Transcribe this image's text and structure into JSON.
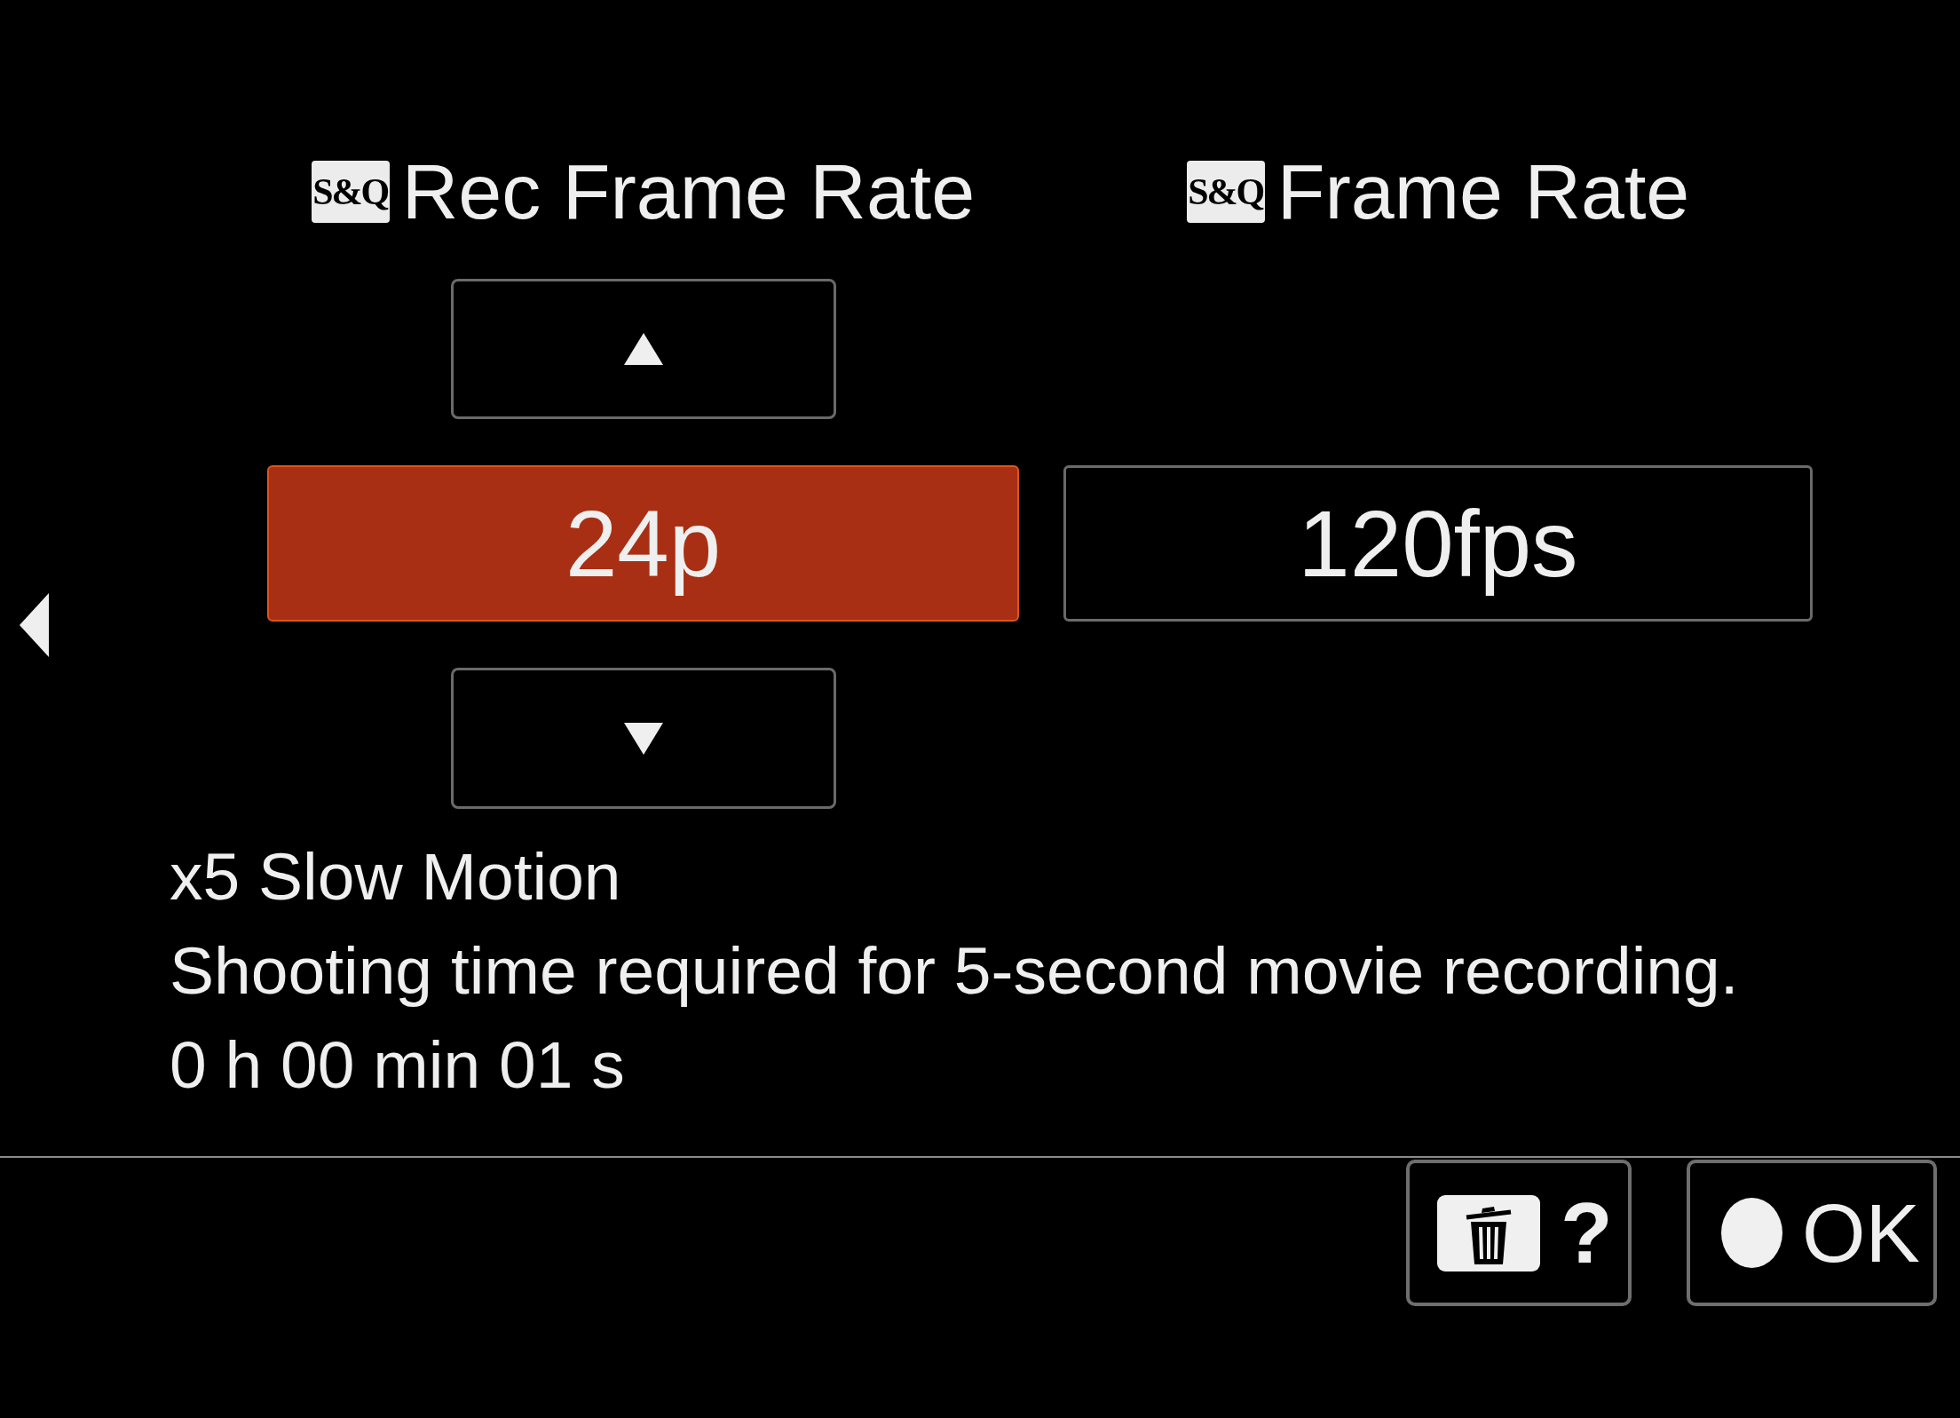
{
  "columns": [
    {
      "kind": "spinner",
      "badge": "S&Q",
      "title": "Rec Frame Rate",
      "value": "24p",
      "selected": true
    },
    {
      "kind": "plain",
      "badge": "S&Q",
      "title": "Frame Rate",
      "value": "120fps",
      "selected": false
    }
  ],
  "info": {
    "mode": "x5 Slow Motion",
    "description": "Shooting time required for 5-second movie recording.",
    "duration": "0 h 00 min 01 s"
  },
  "buttons": [
    {
      "kind": "help",
      "label": "?"
    },
    {
      "kind": "ok",
      "label": "OK"
    }
  ]
}
